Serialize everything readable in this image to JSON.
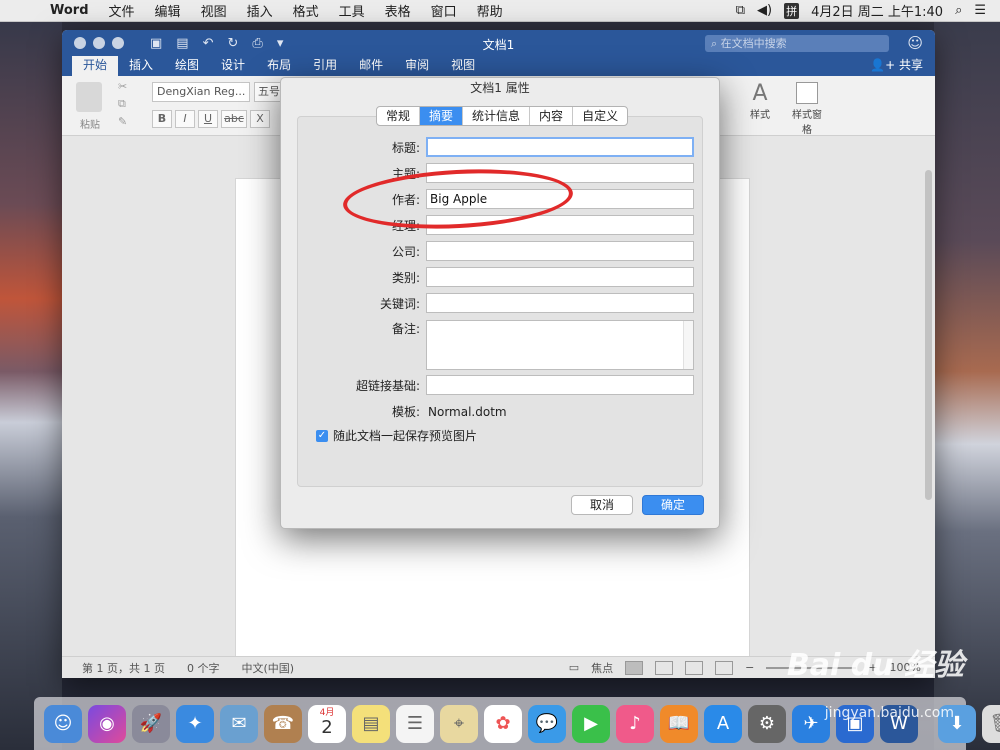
{
  "menubar": {
    "app": "Word",
    "items": [
      "文件",
      "编辑",
      "视图",
      "插入",
      "格式",
      "工具",
      "表格",
      "窗口",
      "帮助"
    ],
    "clock": "4月2日 周二 上午1:40",
    "input_method": "拼"
  },
  "window": {
    "title": "文档1",
    "search_placeholder": "在文档中搜索",
    "share_label": "共享",
    "tabs": [
      "开始",
      "插入",
      "绘图",
      "设计",
      "布局",
      "引用",
      "邮件",
      "审阅",
      "视图"
    ],
    "ribbon": {
      "paste_label": "粘贴",
      "font_name": "DengXian Reg...",
      "font_size": "五号",
      "bold": "B",
      "italic": "I",
      "underline": "U",
      "strike": "abc",
      "clear": "X",
      "styles_label": "样式",
      "styles_pane_label": "样式窗格"
    },
    "status": {
      "page": "第 1 页，共 1 页",
      "words": "0 个字",
      "language": "中文(中国)",
      "focus": "焦点",
      "zoom": "100%"
    }
  },
  "dialog": {
    "title": "文档1 属性",
    "tabs": [
      "常规",
      "摘要",
      "统计信息",
      "内容",
      "自定义"
    ],
    "active_tab": "摘要",
    "fields": {
      "title_label": "标题:",
      "title_value": "",
      "subject_label": "主题:",
      "subject_value": "",
      "author_label": "作者:",
      "author_value": "Big Apple",
      "manager_label": "经理:",
      "manager_value": "",
      "company_label": "公司:",
      "company_value": "",
      "category_label": "类别:",
      "category_value": "",
      "keywords_label": "关键词:",
      "keywords_value": "",
      "comments_label": "备注:",
      "comments_value": "",
      "hyperlink_label": "超链接基础:",
      "hyperlink_value": "",
      "template_label": "模板:",
      "template_value": "Normal.dotm"
    },
    "save_preview_label": "随此文档一起保存预览图片",
    "cancel_label": "取消",
    "ok_label": "确定"
  },
  "dock": {
    "calendar_day": "2",
    "calendar_month": "4月"
  },
  "watermark": {
    "brand": "Bai du 经验",
    "url": "jingyan.baidu.com"
  },
  "colors": {
    "word_blue": "#2b579a",
    "accent_blue": "#3b8ef0",
    "annotation_red": "#e12a2a"
  }
}
